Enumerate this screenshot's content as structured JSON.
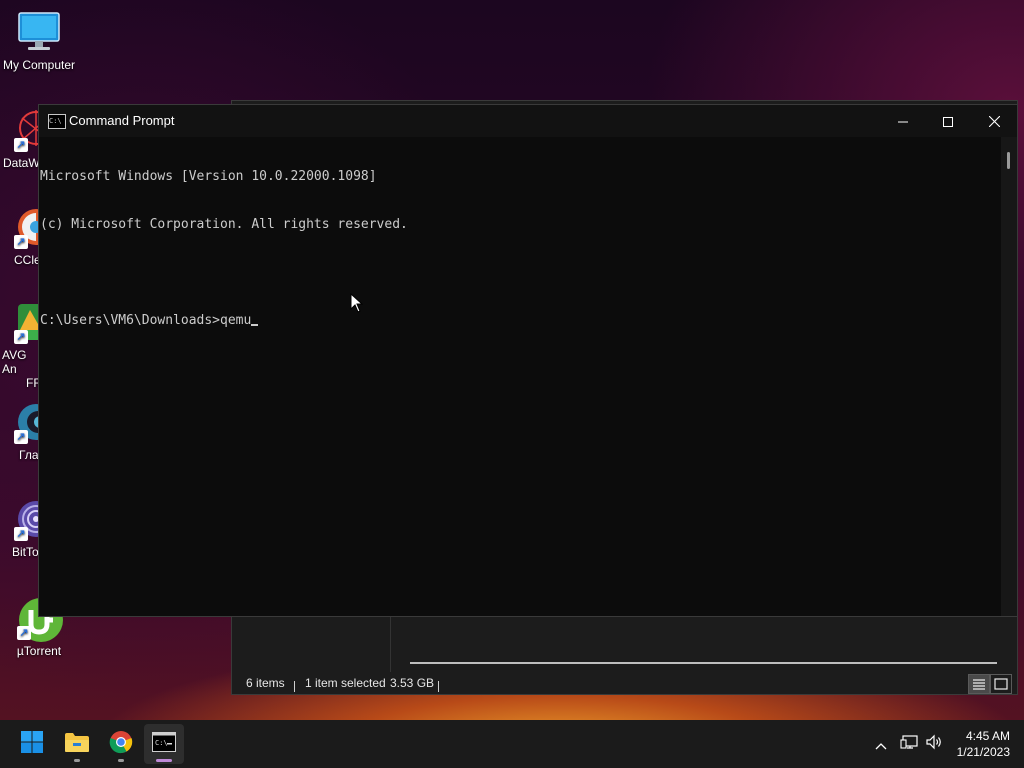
{
  "desktop": {
    "icons": [
      {
        "label": "My Computer",
        "icon": "monitor-icon"
      },
      {
        "label": "DataW",
        "icon": "datawrapper-icon"
      },
      {
        "label": "CCle",
        "icon": "ccleaner-icon"
      },
      {
        "label": "AVG An",
        "label2": "FR",
        "icon": "avg-antivirus-icon"
      },
      {
        "label": "Гла",
        "icon": "app-swirl-icon"
      },
      {
        "label": "BitTo",
        "icon": "bittorrent-icon"
      },
      {
        "label": "µTorrent",
        "icon": "utorrent-icon"
      }
    ]
  },
  "explorer": {
    "status": {
      "items": "6 items",
      "selected": "1 item selected",
      "size": "3.53 GB"
    },
    "views": [
      "details-view-icon",
      "large-icons-view-icon"
    ]
  },
  "cmd": {
    "title": "Command Prompt",
    "icon": "cmd-app-icon",
    "lines": [
      "Microsoft Windows [Version 10.0.22000.1098]",
      "(c) Microsoft Corporation. All rights reserved.",
      "",
      "C:\\Users\\VM6\\Downloads>qemu"
    ],
    "controls": [
      "minimize-icon",
      "maximize-icon",
      "close-icon"
    ]
  },
  "taskbar": {
    "apps": [
      {
        "name": "start",
        "icon": "windows-start-icon"
      },
      {
        "name": "file-explorer",
        "icon": "folder-icon"
      },
      {
        "name": "chrome",
        "icon": "chrome-icon"
      },
      {
        "name": "command-prompt",
        "icon": "cmd-app-icon",
        "active": true
      }
    ],
    "tray": {
      "icons": [
        "chevron-up-icon",
        "network-icon",
        "volume-icon"
      ],
      "time": "4:45 AM",
      "date": "1/21/2023"
    }
  },
  "colors": {
    "accent": "#0078d4",
    "console_bg": "#0c0c0c",
    "console_text": "#cccccc",
    "taskbar_bg": "#1b1b1b"
  }
}
